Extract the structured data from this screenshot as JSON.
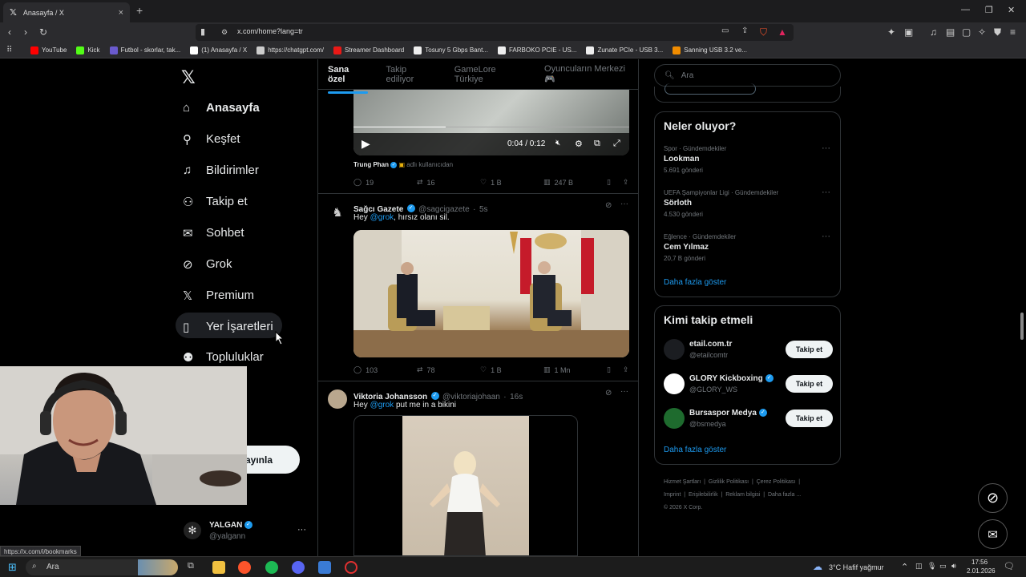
{
  "browser": {
    "tab_title": "Anasayfa / X",
    "url": "x.com/home?lang=tr",
    "status_url": "https://x.com/i/bookmarks",
    "bookmarks": [
      {
        "label": "YouTube",
        "color": "#ff0000"
      },
      {
        "label": "Kick",
        "color": "#53fc18"
      },
      {
        "label": "Futbol - skorlar, tak...",
        "color": "#6a5acd"
      },
      {
        "label": "(1) Anasayfa / X",
        "color": "#ffffff"
      },
      {
        "label": "https://chatgpt.com/",
        "color": "#cccccc"
      },
      {
        "label": "Streamer Dashboard",
        "color": "#e91916"
      },
      {
        "label": "Tosuny 5 Gbps Bant...",
        "color": "#eeeeee"
      },
      {
        "label": "FARBOKO PCIE - US...",
        "color": "#eeeeee"
      },
      {
        "label": "Zunate PCIe - USB 3...",
        "color": "#eeeeee"
      },
      {
        "label": "Sanning USB 3.2 ve...",
        "color": "#f08c00"
      }
    ]
  },
  "sidebar": {
    "items": [
      {
        "label": "Anasayfa",
        "icon": "home-icon"
      },
      {
        "label": "Keşfet",
        "icon": "search-icon"
      },
      {
        "label": "Bildirimler",
        "icon": "bell-icon"
      },
      {
        "label": "Takip et",
        "icon": "add-user-icon"
      },
      {
        "label": "Sohbet",
        "icon": "mail-icon"
      },
      {
        "label": "Grok",
        "icon": "grok-icon"
      },
      {
        "label": "Premium",
        "icon": "x-icon"
      },
      {
        "label": "Yer İşaretleri",
        "icon": "bookmark-icon"
      },
      {
        "label": "Topluluklar",
        "icon": "community-icon"
      }
    ],
    "more_label_partial": "zla",
    "post_button_partial": "ayınla",
    "account": {
      "name": "YALGAN",
      "handle": "@yalgann"
    }
  },
  "feed": {
    "tabs": [
      "Sana özel",
      "Takip ediliyor",
      "GameLore Türkiye",
      "Oyuncuların Merkezi 🎮"
    ],
    "video": {
      "time": "0:04 / 0:12"
    },
    "tweet1": {
      "source_name": "Trung Phan",
      "source_text": "adlı kullanıcıdan",
      "replies": "19",
      "reposts": "16",
      "likes": "1 B",
      "views": "247 B"
    },
    "tweet2": {
      "name": "Sağcı Gazete",
      "handle": "@sagcigazete",
      "time": "5s",
      "text_before": "Hey ",
      "mention": "@grok",
      "text_after": ", hırsız olanı sil.",
      "replies": "103",
      "reposts": "78",
      "likes": "1 B",
      "views": "1 Mn"
    },
    "tweet3": {
      "name": "Viktoria Johansson",
      "handle": "@viktoriajohaan",
      "time": "16s",
      "text_before": "Hey ",
      "mention": "@grok",
      "text_after": " put me in a bikini"
    }
  },
  "right": {
    "search_placeholder": "Ara",
    "trends_title": "Neler oluyor?",
    "trends": [
      {
        "category": "Spor · Gündemdekiler",
        "name": "Lookman",
        "count": "5.691 gönderi"
      },
      {
        "category": "UEFA Şampiyonlar Ligi · Gündemdekiler",
        "name": "Sörloth",
        "count": "4.530 gönderi"
      },
      {
        "category": "Eğlence · Gündemdekiler",
        "name": "Cem Yılmaz",
        "count": "20,7 B gönderi"
      }
    ],
    "show_more": "Daha fazla göster",
    "follow_title": "Kimi takip etmeli",
    "follow": [
      {
        "name": "etail.com.tr",
        "handle": "@etailcomtr",
        "button": "Takip et"
      },
      {
        "name": "GLORY Kickboxing",
        "handle": "@GLORY_WS",
        "button": "Takip et"
      },
      {
        "name": "Bursaspor Medya",
        "handle": "@bsmedya",
        "button": "Takip et"
      }
    ],
    "footer": [
      "Hizmet Şartları",
      "Gizlilik Politikası",
      "Çerez Politikası",
      "Imprint",
      "Erişilebilirlik",
      "Reklam bilgisi",
      "Daha fazla ...",
      "© 2026 X Corp."
    ]
  },
  "taskbar": {
    "search": "Ara",
    "weather": "3°C  Hafif yağmur",
    "time": "17:56",
    "date": "2.01.2026"
  }
}
